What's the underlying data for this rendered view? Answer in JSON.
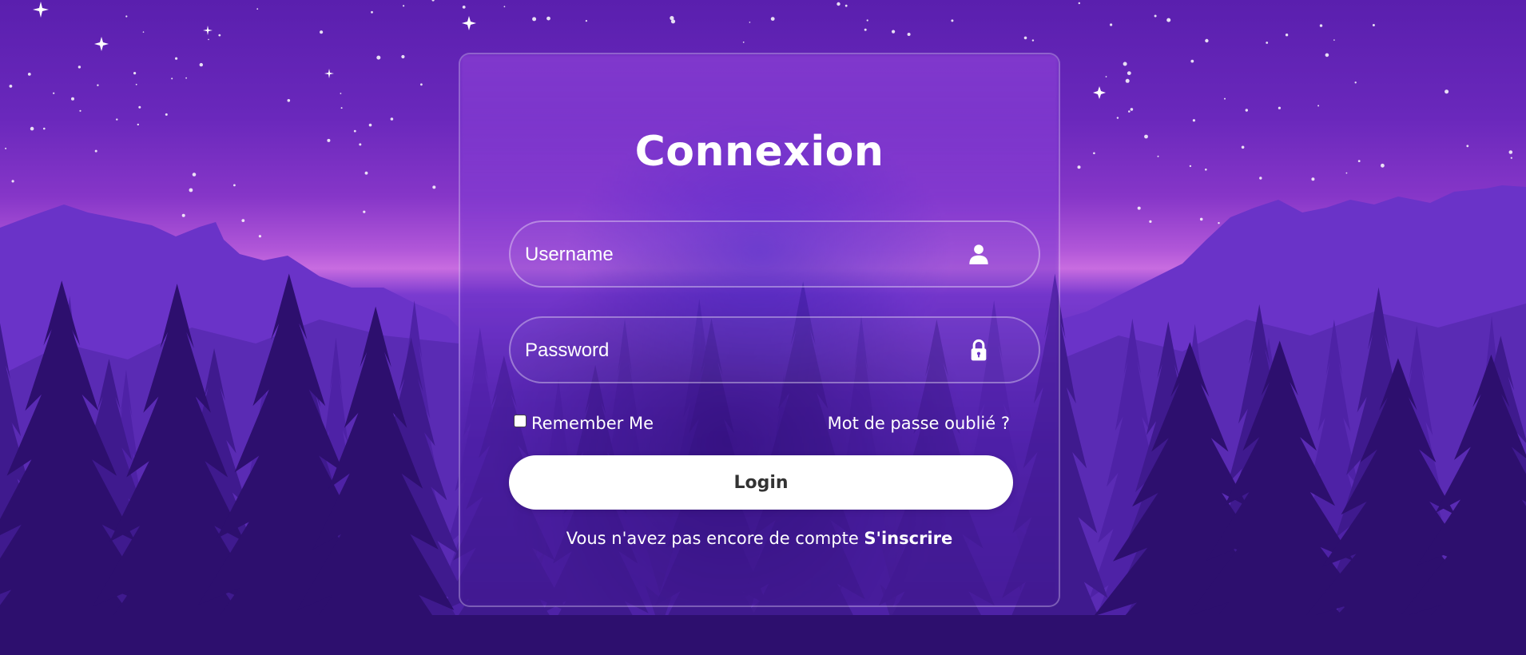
{
  "login": {
    "title": "Connexion",
    "username_placeholder": "Username",
    "password_placeholder": "Password",
    "remember_label": "Remember Me",
    "forgot_label": "Mot de passe oublié ?",
    "submit_label": "Login",
    "no_account_text": "Vous n'avez pas encore de compte ",
    "register_label": "S'inscrire"
  },
  "icons": {
    "username": "user-icon",
    "password": "lock-icon"
  },
  "colors": {
    "accent": "#7b3fd6",
    "text": "#ffffff",
    "button_bg": "#ffffff",
    "button_text": "#333333"
  }
}
